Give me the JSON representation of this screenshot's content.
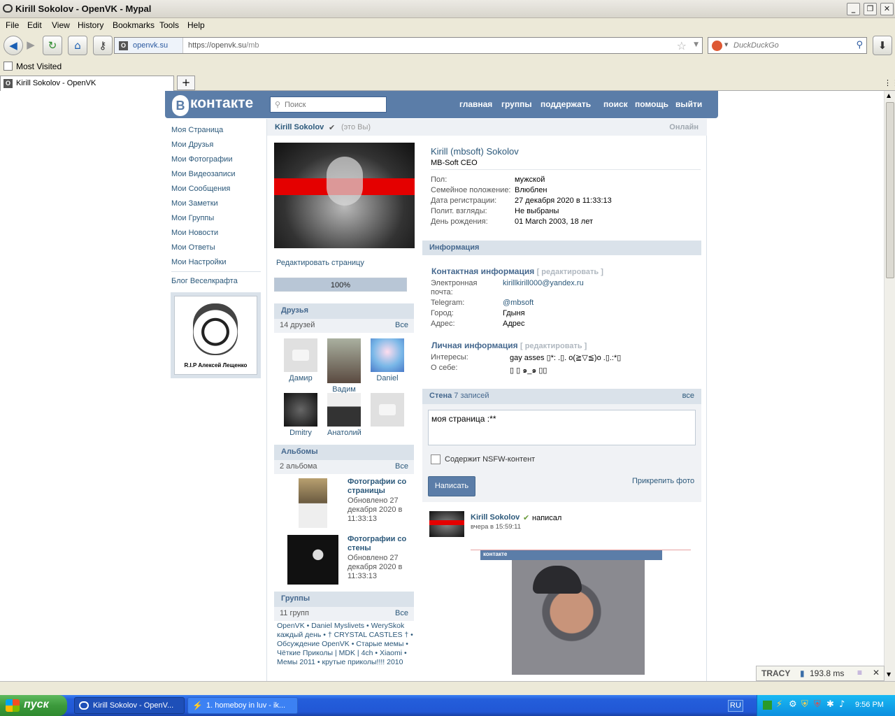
{
  "window": {
    "title": "Kirill Sokolov - OpenVK - Mypal"
  },
  "menu": [
    "File",
    "Edit",
    "View",
    "History",
    "Bookmarks",
    "Tools",
    "Help"
  ],
  "nav": {
    "site": "openvk.su",
    "url_host": "https://openvk.su",
    "url_path": "/mb",
    "search_placeholder": "DuckDuckGo"
  },
  "bookmarks": {
    "most_visited": "Most Visited"
  },
  "tab": {
    "label": "Kirill Sokolov - OpenVK"
  },
  "vk": {
    "logo_text": "контакте",
    "logo_letter": "В",
    "search_placeholder": "Поиск",
    "topnav": [
      "главная",
      "группы",
      "поддержать",
      "поиск",
      "помощь",
      "выйти"
    ],
    "leftnav": [
      "Моя Страница",
      "Мои Друзья",
      "Мои Фотографии",
      "Мои Видеозаписи",
      "Мои Сообщения",
      "Мои Заметки",
      "Мои Группы",
      "Мои Новости",
      "Мои Ответы",
      "Мои Настройки"
    ],
    "blog": "Блог Веселкрафта",
    "ad_caption": "R.I.P Алексей Лещенко",
    "header": {
      "name": "Kirill Sokolov",
      "check": "✔",
      "you": "(это Вы)",
      "status": "Онлайн"
    },
    "profile": {
      "fullname": "Kirill (mbsoft) Sokolov",
      "tagline": "MB-Soft CEO",
      "fields": [
        {
          "label": "Пол:",
          "value": "мужской"
        },
        {
          "label": "Семейное положение:",
          "value": "Влюблен"
        },
        {
          "label": "Дата регистрации:",
          "value": "27 декабря 2020 в 11:33:13"
        },
        {
          "label": "Полит. взгляды:",
          "value": "Не выбраны"
        },
        {
          "label": "День рождения:",
          "value": "01 March 2003, 18 лет"
        }
      ]
    },
    "edit_page": "Редактировать страницу",
    "completion": "100%",
    "completion_fraction": 1.0,
    "friends": {
      "title": "Друзья",
      "count": "14 друзей",
      "all": "Все",
      "items": [
        "Дамир",
        "Вадим",
        "Daniel",
        "Dmitry",
        "Анатолий",
        ""
      ]
    },
    "albums": {
      "title": "Альбомы",
      "count": "2 альбома",
      "all": "Все",
      "items": [
        {
          "title": "Фотографии со страницы",
          "updated": "Обновлено 27 декабря 2020 в 11:33:13"
        },
        {
          "title": "Фотографии со стены",
          "updated": "Обновлено 27 декабря 2020 в 11:33:13"
        }
      ]
    },
    "groups": {
      "title": "Группы",
      "count": "11 групп",
      "all": "Все",
      "text": "OpenVK • Daniel Myslivets • WerySkok каждый день • † CRYSTAL CASTLES † • Обсуждение OpenVK • Старые мемы • Чёткие Приколы | MDK | 4ch • Xiaomi • Мемы 2011 • крутые приколы!!!! 2010"
    },
    "info": {
      "title": "Информация",
      "contact_title": "Контактная информация",
      "edit": "[ редактировать ]",
      "contact": [
        {
          "label": "Электронная почта:",
          "value": "kirillkirill000@yandex.ru"
        },
        {
          "label": "Telegram:",
          "value": "@mbsoft"
        },
        {
          "label": "Город:",
          "value": "Гдыня"
        },
        {
          "label": "Адрес:",
          "value": "Адрес"
        }
      ],
      "personal_title": "Личная информация",
      "personal": [
        {
          "label": "Интересы:",
          "value": "gay asses ▯*: .▯. o(≧▽≦)o .▯.:*▯"
        },
        {
          "label": "О себе:",
          "value": "▯ ▯ ๑_๑ ▯▯"
        }
      ]
    },
    "wall": {
      "title": "Стена",
      "count": "7 записей",
      "all": "все",
      "draft": "моя страница :**",
      "nsfw": "Содержит NSFW-контент",
      "submit": "Написать",
      "attach": "Прикрепить фото",
      "post": {
        "author": "Kirill Sokolov",
        "verb": "написал",
        "time": "вчера в 15:59:11",
        "inner_logo": "контакте"
      }
    }
  },
  "tracy": {
    "label": "TRACY",
    "time": "193.8 ms"
  },
  "taskbar": {
    "start": "пуск",
    "tasks": [
      "Kirill Sokolov - OpenV...",
      "1. homeboy in luv - ik..."
    ],
    "lang": "RU",
    "clock": "9:56 PM"
  }
}
